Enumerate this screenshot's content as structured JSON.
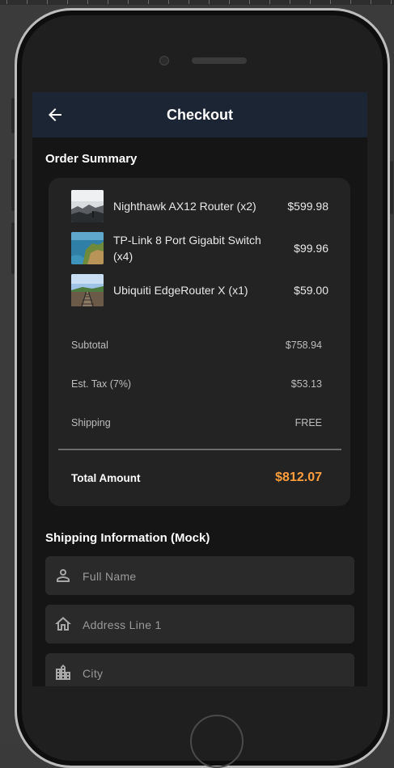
{
  "app_bar": {
    "title": "Checkout",
    "back_icon": "arrow-back-icon"
  },
  "order_summary": {
    "title": "Order Summary",
    "items": [
      {
        "name": "Nighthawk AX12 Router (x2)",
        "price": "$599.98",
        "thumb": "misty-landscape"
      },
      {
        "name": "TP-Link 8 Port Gigabit Switch (x4)",
        "price": "$99.96",
        "thumb": "coastal-cliff"
      },
      {
        "name": "Ubiquiti EdgeRouter X (x1)",
        "price": "$59.00",
        "thumb": "railway-tracks"
      }
    ],
    "subtotal_label": "Subtotal",
    "subtotal_value": "$758.94",
    "tax_label": "Est. Tax (7%)",
    "tax_value": "$53.13",
    "shipping_label": "Shipping",
    "shipping_value": "FREE",
    "total_label": "Total Amount",
    "total_value": "$812.07"
  },
  "shipping": {
    "title": "Shipping Information (Mock)",
    "fields": [
      {
        "placeholder": "Full Name",
        "icon": "person-icon"
      },
      {
        "placeholder": "Address Line 1",
        "icon": "home-icon"
      },
      {
        "placeholder": "City",
        "icon": "city-icon"
      }
    ]
  },
  "colors": {
    "app_bar": "#1c2534",
    "background": "#151515",
    "card": "#232323",
    "total_accent": "#ff9e3d"
  }
}
